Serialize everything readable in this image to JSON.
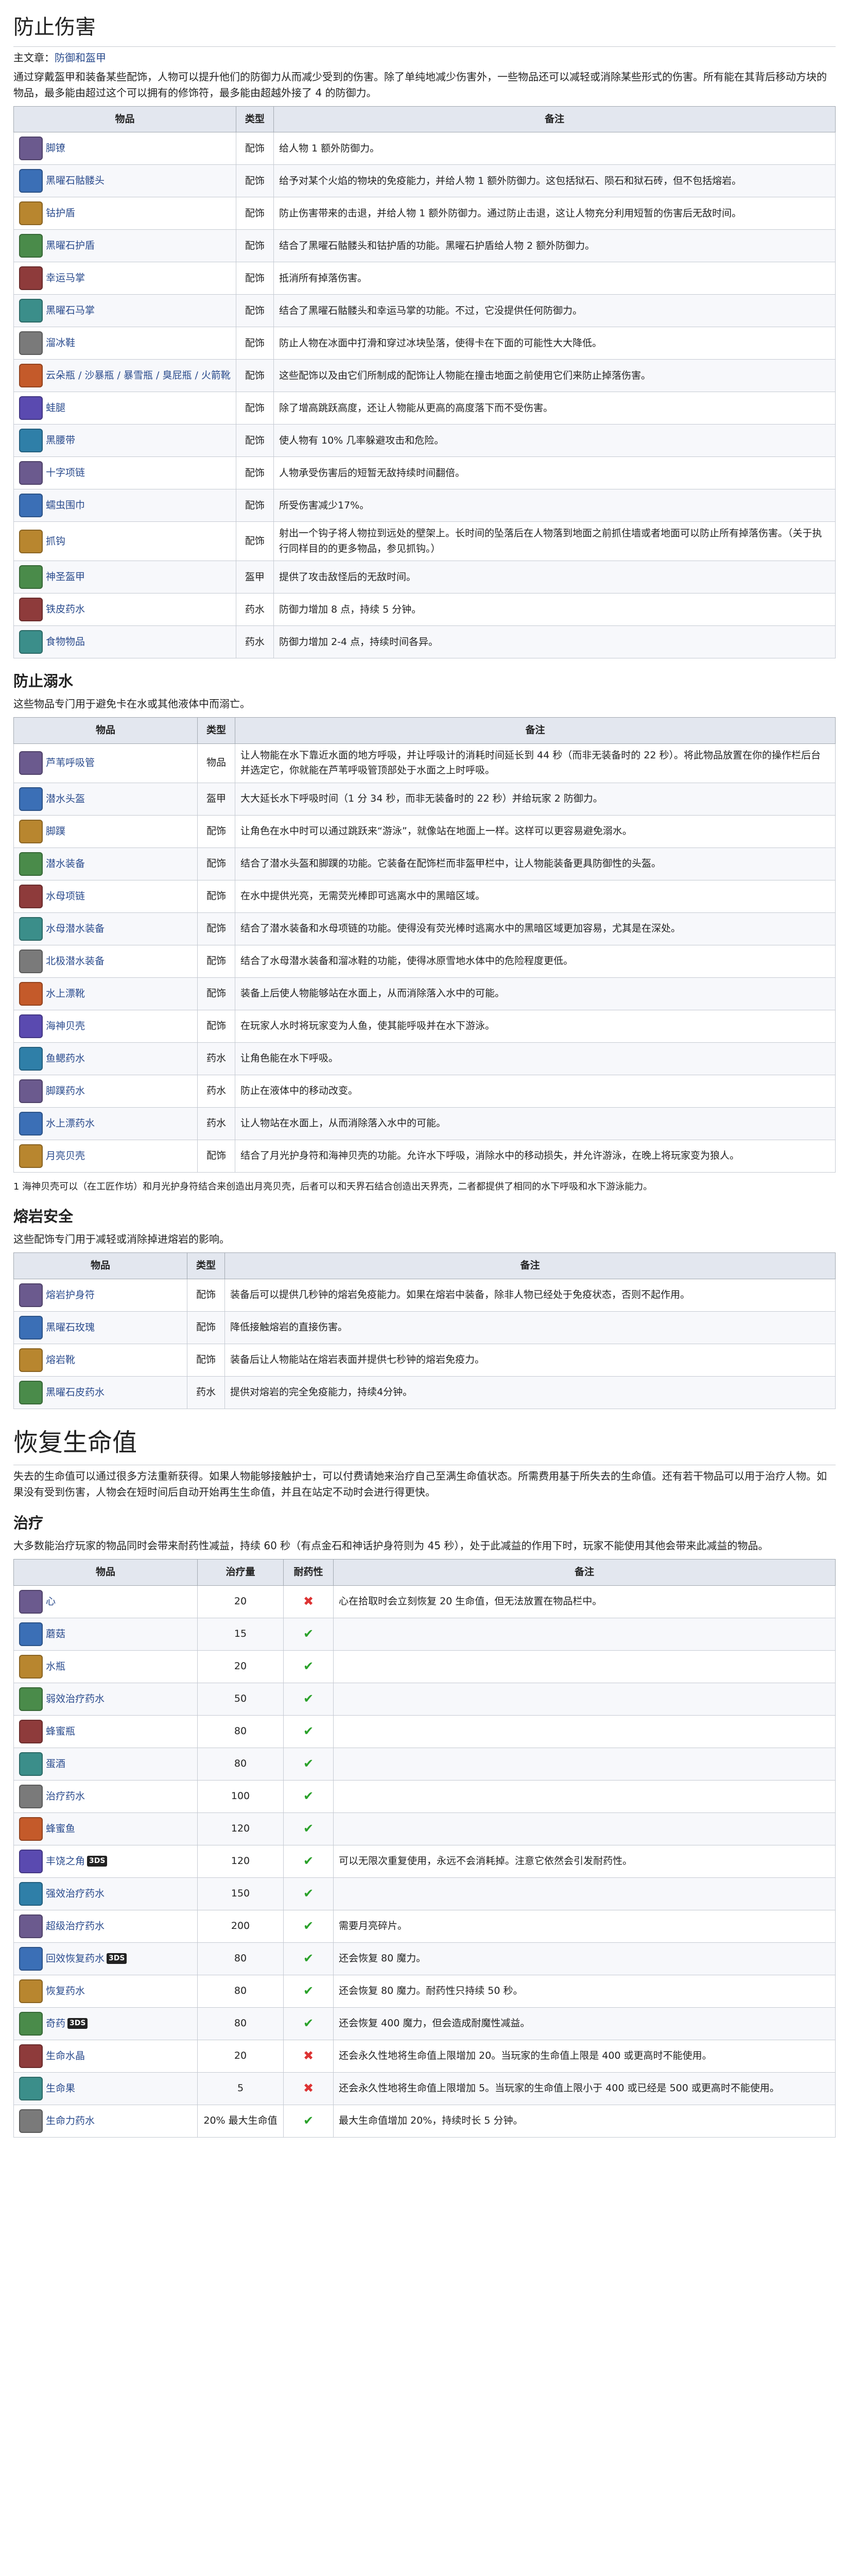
{
  "s1": {
    "title": "防止伤害",
    "main_prefix": "主文章：",
    "main_links": "防御和盔甲",
    "intro": "通过穿戴盔甲和装备某些配饰，人物可以提升他们的防御力从而减少受到的伤害。除了单纯地减少伤害外，一些物品还可以减轻或消除某些形式的伤害。所有能在其背后移动方块的物品，最多能由超过这个可以拥有的修饰符，最多能由超越外接了 4 的防御力。",
    "headers": [
      "物品",
      "类型",
      "备注"
    ],
    "rows": [
      {
        "item": "脚镣",
        "type": "配饰",
        "note": "给人物 1 额外防御力。"
      },
      {
        "item": "黑曜石骷髅头",
        "type": "配饰",
        "note": "给予对某个火焰的物块的免疫能力，并给人物 1 额外防御力。这包括狱石、陨石和狱石砖，但不包括熔岩。"
      },
      {
        "item": "钴护盾",
        "type": "配饰",
        "note": "防止伤害带来的击退，并给人物 1 额外防御力。通过防止击退，这让人物充分利用短暂的伤害后无敌时间。"
      },
      {
        "item": "黑曜石护盾",
        "type": "配饰",
        "note": "结合了黑曜石骷髅头和钴护盾的功能。黑曜石护盾给人物 2 额外防御力。"
      },
      {
        "item": "幸运马掌",
        "type": "配饰",
        "note": "抵消所有掉落伤害。"
      },
      {
        "item": "黑曜石马掌",
        "type": "配饰",
        "note": "结合了黑曜石骷髅头和幸运马掌的功能。不过，它没提供任何防御力。"
      },
      {
        "item": "溜冰鞋",
        "type": "配饰",
        "note": "防止人物在冰面中打滑和穿过冰块坠落，使得卡在下面的可能性大大降低。"
      },
      {
        "item": "云朵瓶 / 沙暴瓶 / 暴雪瓶 / 臭屁瓶 / 火箭靴",
        "type": "配饰",
        "note": "这些配饰以及由它们所制成的配饰让人物能在撞击地面之前使用它们来防止掉落伤害。"
      },
      {
        "item": "蛙腿",
        "type": "配饰",
        "note": "除了增高跳跃高度，还让人物能从更高的高度落下而不受伤害。"
      },
      {
        "item": "黑腰带",
        "type": "配饰",
        "note": "使人物有 10% 几率躲避攻击和危险。"
      },
      {
        "item": "十字项链",
        "type": "配饰",
        "note": "人物承受伤害后的短暂无敌持续时间翻倍。"
      },
      {
        "item": "蠕虫围巾",
        "type": "配饰",
        "note": "所受伤害减少17%。"
      },
      {
        "item": "抓钩",
        "type": "配饰",
        "note": "射出一个钩子将人物拉到远处的壁架上。长时间的坠落后在人物落到地面之前抓住墙或者地面可以防止所有掉落伤害。（关于执行同样目的的更多物品，参见抓钩。）"
      },
      {
        "item": "神圣盔甲",
        "type": "盔甲",
        "note": "提供了攻击敌怪后的无敌时间。"
      },
      {
        "item": "铁皮药水",
        "type": "药水",
        "note": "防御力增加 8 点，持续 5 分钟。"
      },
      {
        "item": "食物物品",
        "type": "药水",
        "note": "防御力增加 2-4 点，持续时间各异。"
      }
    ]
  },
  "s2": {
    "title": "防止溺水",
    "intro": "这些物品专门用于避免卡在水或其他液体中而溺亡。",
    "headers": [
      "物品",
      "类型",
      "备注"
    ],
    "rows": [
      {
        "item": "芦苇呼吸管",
        "type": "物品",
        "note": "让人物能在水下靠近水面的地方呼吸，并让呼吸计的消耗时间延长到 44 秒（而非无装备时的 22 秒）。将此物品放置在你的操作栏后台并选定它，你就能在芦苇呼吸管顶部处于水面之上时呼吸。"
      },
      {
        "item": "潜水头盔",
        "type": "盔甲",
        "note": "大大延长水下呼吸时间（1 分 34 秒，而非无装备时的 22 秒）并给玩家 2 防御力。"
      },
      {
        "item": "脚蹼",
        "type": "配饰",
        "note": "让角色在水中时可以通过跳跃来“游泳”，就像站在地面上一样。这样可以更容易避免溺水。"
      },
      {
        "item": "潜水装备",
        "type": "配饰",
        "note": "结合了潜水头盔和脚蹼的功能。它装备在配饰栏而非盔甲栏中，让人物能装备更具防御性的头盔。"
      },
      {
        "item": "水母项链",
        "type": "配饰",
        "note": "在水中提供光亮，无需荧光棒即可逃离水中的黑暗区域。"
      },
      {
        "item": "水母潜水装备",
        "type": "配饰",
        "note": "结合了潜水装备和水母项链的功能。使得没有荧光棒时逃离水中的黑暗区域更加容易，尤其是在深处。"
      },
      {
        "item": "北极潜水装备",
        "type": "配饰",
        "note": "结合了水母潜水装备和溜冰鞋的功能，使得冰原雪地水体中的危险程度更低。"
      },
      {
        "item": "水上漂靴",
        "type": "配饰",
        "note": "装备上后使人物能够站在水面上，从而消除落入水中的可能。"
      },
      {
        "item": "海神贝壳",
        "type": "配饰",
        "note": "在玩家人水时将玩家变为人鱼，使其能呼吸并在水下游泳。"
      },
      {
        "item": "鱼鳃药水",
        "type": "药水",
        "note": "让角色能在水下呼吸。"
      },
      {
        "item": "脚蹼药水",
        "type": "药水",
        "note": "防止在液体中的移动改变。"
      },
      {
        "item": "水上漂药水",
        "type": "药水",
        "note": "让人物站在水面上，从而消除落入水中的可能。"
      },
      {
        "item": "月亮贝壳",
        "type": "配饰",
        "note": "结合了月光护身符和海神贝壳的功能。允许水下呼吸，消除水中的移动损失，并允许游泳，在晚上将玩家变为狼人。"
      }
    ],
    "footnote": "1 海神贝壳可以（在工匠作坊）和月光护身符结合来创造出月亮贝壳，后者可以和天界石结合创造出天界壳，二者都提供了相同的水下呼吸和水下游泳能力。"
  },
  "s3": {
    "title": "熔岩安全",
    "intro": "这些配饰专门用于减轻或消除掉进熔岩的影响。",
    "headers": [
      "物品",
      "类型",
      "备注"
    ],
    "rows": [
      {
        "item": "熔岩护身符",
        "type": "配饰",
        "note": "装备后可以提供几秒钟的熔岩免疫能力。如果在熔岩中装备，除非人物已经处于免疫状态，否则不起作用。"
      },
      {
        "item": "黑曜石玫瑰",
        "type": "配饰",
        "note": "降低接触熔岩的直接伤害。"
      },
      {
        "item": "熔岩靴",
        "type": "配饰",
        "note": "装备后让人物能站在熔岩表面并提供七秒钟的熔岩免疫力。"
      },
      {
        "item": "黑曜石皮药水",
        "type": "药水",
        "note": "提供对熔岩的完全免疫能力，持续4分钟。"
      }
    ]
  },
  "s4": {
    "title": "恢复生命值",
    "intro": "失去的生命值可以通过很多方法重新获得。如果人物能够接触护士，可以付费请她来治疗自己至满生命值状态。所需费用基于所失去的生命值。还有若干物品可以用于治疗人物。如果没有受到伤害，人物会在短时间后自动开始再生生命值，并且在站定不动时会进行得更快。",
    "sub_title": "治疗",
    "sub_intro": "大多数能治疗玩家的物品同时会带来耐药性减益，持续 60 秒（有点金石和神话护身符则为 45 秒），处于此减益的作用下时，玩家不能使用其他会带来此减益的物品。",
    "headers": [
      "物品",
      "治疗量",
      "耐药性",
      "备注"
    ],
    "rows": [
      {
        "item": "心",
        "amount": "20",
        "sick": "no",
        "note": "心在拾取时会立刻恢复 20 生命值，但无法放置在物品栏中。"
      },
      {
        "item": "蘑菇",
        "amount": "15",
        "sick": "yes",
        "note": ""
      },
      {
        "item": "水瓶",
        "amount": "20",
        "sick": "yes",
        "note": ""
      },
      {
        "item": "弱效治疗药水",
        "amount": "50",
        "sick": "yes",
        "note": ""
      },
      {
        "item": "蜂蜜瓶",
        "amount": "80",
        "sick": "yes",
        "note": ""
      },
      {
        "item": "蛋酒",
        "amount": "80",
        "sick": "yes",
        "note": ""
      },
      {
        "item": "治疗药水",
        "amount": "100",
        "sick": "yes",
        "note": ""
      },
      {
        "item": "蜂蜜鱼",
        "amount": "120",
        "sick": "yes",
        "note": ""
      },
      {
        "item": "丰饶之角",
        "tag": "3DS",
        "amount": "120",
        "sick": "yes",
        "note": "可以无限次重复使用，永远不会消耗掉。注意它依然会引发耐药性。"
      },
      {
        "item": "强效治疗药水",
        "amount": "150",
        "sick": "yes",
        "note": ""
      },
      {
        "item": "超级治疗药水",
        "amount": "200",
        "sick": "yes",
        "note": "需要月亮碎片。"
      },
      {
        "item": "回效恢复药水",
        "tag": "3DS",
        "amount": "80",
        "sick": "yes",
        "note": "还会恢复 80 魔力。"
      },
      {
        "item": "恢复药水",
        "amount": "80",
        "sick": "yes",
        "note": "还会恢复 80 魔力。耐药性只持续 50 秒。"
      },
      {
        "item": "奇药",
        "tag": "3DS",
        "amount": "80",
        "sick": "yes",
        "note": "还会恢复 400 魔力，但会造成耐魔性减益。"
      },
      {
        "item": "生命水晶",
        "amount": "20",
        "sick": "no",
        "note": "还会永久性地将生命值上限增加 20。当玩家的生命值上限是 400 或更高时不能使用。"
      },
      {
        "item": "生命果",
        "amount": "5",
        "sick": "no",
        "note": "还会永久性地将生命值上限增加 5。当玩家的生命值上限小于 400 或已经是 500 或更高时不能使用。"
      },
      {
        "item": "生命力药水",
        "amount": "20% 最大生命值",
        "sick": "yes",
        "note": "最大生命值增加 20%，持续时长 5 分钟。"
      }
    ]
  },
  "colors": {
    "link": "#2a4b8d",
    "header_bg": "#e3e7ef",
    "check": "#2aa12a",
    "cross": "#dd3333"
  }
}
